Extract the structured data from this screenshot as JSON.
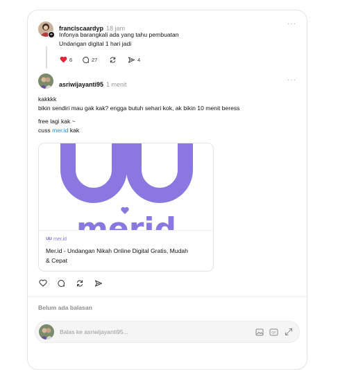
{
  "parent_post": {
    "username": "franciscaardyp",
    "time": "18 jam",
    "text_line1": "Infonya barangkali ada yang tahu pembuatan",
    "text_line2": "Undangan digital 1 hari jadi",
    "likes": "6",
    "replies": "27",
    "shares": "4",
    "liked": true,
    "more": "···"
  },
  "reply_post": {
    "username": "asriwijayanti95",
    "time": "1 menit",
    "more": "···",
    "line1": "kakkkk",
    "line2": "bikin sendiri mau gak kak? engga butuh sehari kok, ak bikin 10 menit beress",
    "line3": "free lagi kak ~",
    "line4_prefix": "cuss ",
    "line4_link": "mer.id",
    "line4_suffix": " kak"
  },
  "link_preview": {
    "domain": "mer.id",
    "title_line1": "Mer.id - Undangan Nikah Online Digital Gratis, Mudah",
    "title_line2": "& Cepat",
    "image_logo_text": "merid"
  },
  "replies_section": {
    "empty_label": "Belum ada balasan"
  },
  "reply_input": {
    "placeholder": "Balas ke asriwijayanti95..."
  },
  "colors": {
    "like_red": "#e0243a",
    "link_blue": "#1a8be0",
    "logo_purple": "#8a78e0"
  }
}
